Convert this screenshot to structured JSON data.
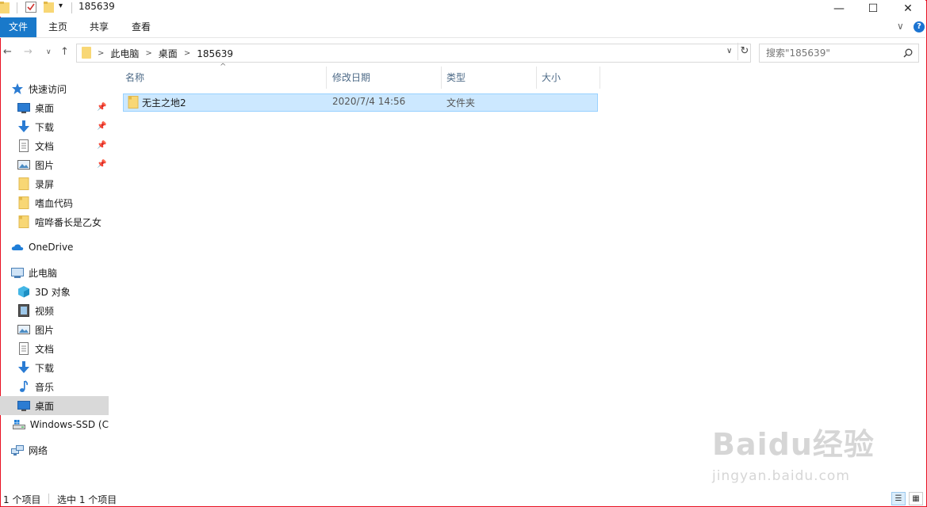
{
  "window": {
    "title": "185639",
    "minimize": "—",
    "maximize": "☐",
    "close": "✕"
  },
  "ribbon": {
    "tabs": [
      "文件",
      "主页",
      "共享",
      "查看"
    ],
    "collapse_icon": "chevron-down-icon",
    "help": "?"
  },
  "nav": {
    "back": "←",
    "forward": "→",
    "recent": "∨",
    "up": "↑"
  },
  "address": {
    "crumbs": [
      "此电脑",
      "桌面",
      "185639"
    ],
    "separator": ">",
    "dropdown": "∨",
    "refresh": "↻"
  },
  "search": {
    "placeholder": "搜索\"185639\""
  },
  "sidebar": {
    "quick_access": "快速访问",
    "quick_items": [
      {
        "label": "桌面",
        "icon": "desktop-icon",
        "pinned": true
      },
      {
        "label": "下载",
        "icon": "download-icon",
        "pinned": true
      },
      {
        "label": "文档",
        "icon": "document-icon",
        "pinned": true
      },
      {
        "label": "图片",
        "icon": "picture-icon",
        "pinned": true
      },
      {
        "label": "录屏",
        "icon": "folder-icon",
        "pinned": false
      },
      {
        "label": "嗜血代码",
        "icon": "folder-icon",
        "pinned": false
      },
      {
        "label": "喧哗番长是乙女",
        "icon": "folder-icon",
        "pinned": false
      }
    ],
    "onedrive": "OneDrive",
    "this_pc": "此电脑",
    "pc_items": [
      {
        "label": "3D 对象",
        "icon": "3d-objects-icon"
      },
      {
        "label": "视频",
        "icon": "video-icon"
      },
      {
        "label": "图片",
        "icon": "picture-icon"
      },
      {
        "label": "文档",
        "icon": "document-icon"
      },
      {
        "label": "下载",
        "icon": "download-icon"
      },
      {
        "label": "音乐",
        "icon": "music-icon"
      },
      {
        "label": "桌面",
        "icon": "desktop-icon",
        "selected": true
      },
      {
        "label": "Windows-SSD (C",
        "icon": "drive-icon"
      }
    ],
    "network": "网络"
  },
  "list": {
    "columns": [
      "名称",
      "修改日期",
      "类型",
      "大小"
    ],
    "sort_caret": "^",
    "rows": [
      {
        "name": "无主之地2",
        "modified": "2020/7/4 14:56",
        "type": "文件夹",
        "size": ""
      }
    ]
  },
  "status": {
    "count": "1 个项目",
    "selected": "选中 1 个项目"
  },
  "watermark": {
    "logo": "Baidu经验",
    "url": "jingyan.baidu.com"
  },
  "colors": {
    "accent": "#1979ca",
    "selection_bg": "#cce8ff",
    "selection_border": "#99d1ff",
    "window_border": "#e81123",
    "folder": "#f8d775"
  }
}
